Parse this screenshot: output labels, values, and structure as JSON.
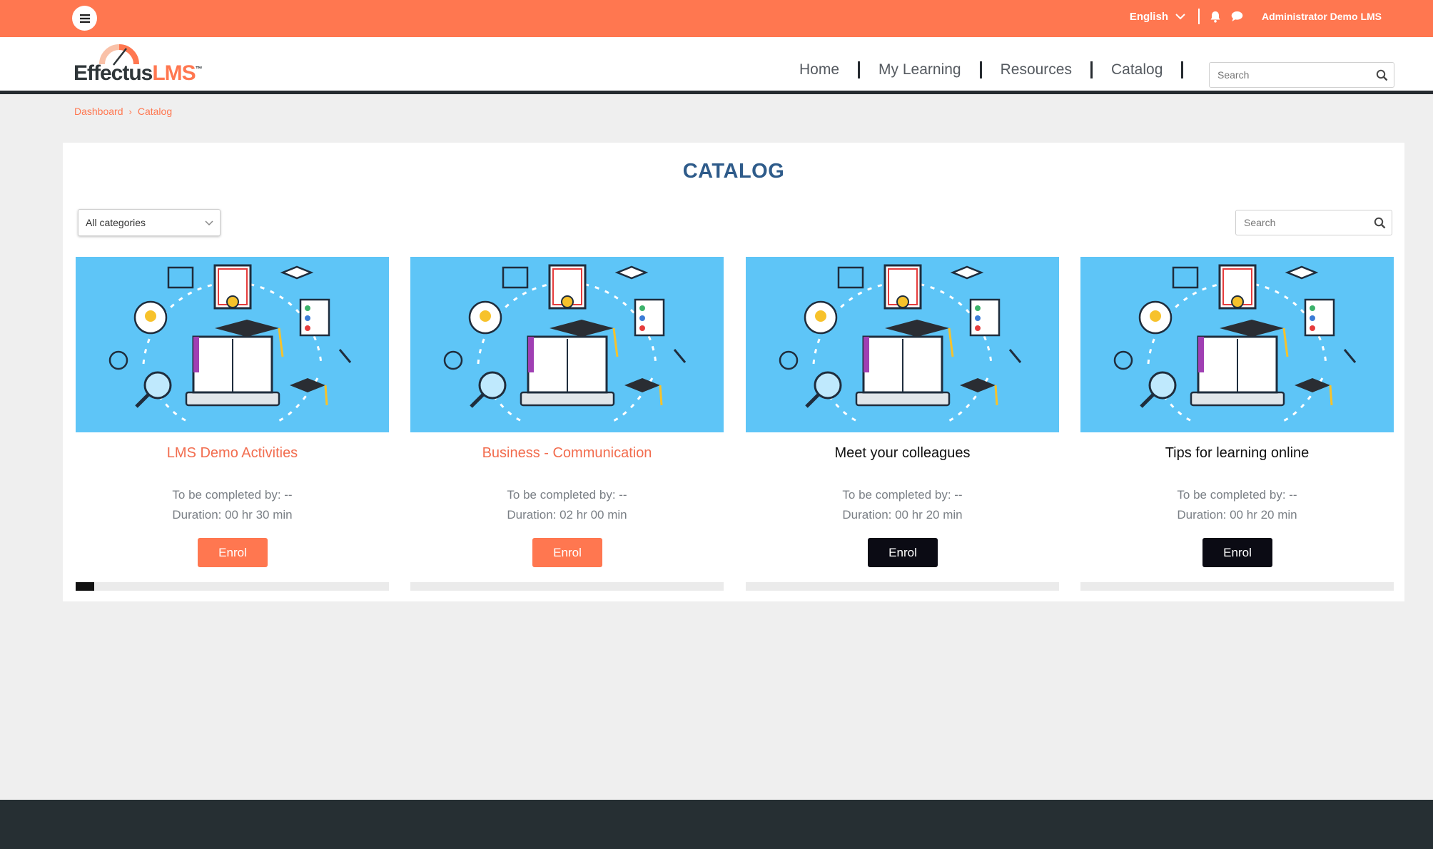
{
  "topbar": {
    "language": "English",
    "user_name": "Administrator Demo LMS"
  },
  "logo": {
    "effectus": "Effectus",
    "lms": "LMS",
    "tm": "™"
  },
  "nav": {
    "home": "Home",
    "my_learning": "My Learning",
    "resources": "Resources",
    "catalog": "Catalog"
  },
  "header_search": {
    "placeholder": "Search"
  },
  "breadcrumb": {
    "dashboard": "Dashboard",
    "catalog": "Catalog"
  },
  "main": {
    "title": "CATALOG",
    "category_filter": "All categories",
    "search_placeholder": "Search"
  },
  "courses": [
    {
      "title": "LMS Demo Activities",
      "completed_by": "To be completed by: --",
      "duration": "Duration: 00 hr 30 min",
      "button": "Enrol",
      "title_color": "#f26d4f",
      "button_color": "#ff7750",
      "progress": 0.06
    },
    {
      "title": "Business - Communication",
      "completed_by": "To be completed by: --",
      "duration": "Duration: 02 hr 00 min",
      "button": "Enrol",
      "title_color": "#f26d4f",
      "button_color": "#ff7750",
      "progress": 0
    },
    {
      "title": "Meet your colleagues",
      "completed_by": "To be completed by: --",
      "duration": "Duration: 00 hr 20 min",
      "button": "Enrol",
      "title_color": "#111111",
      "button_color": "#0b0b14",
      "progress": 0
    },
    {
      "title": "Tips for learning online",
      "completed_by": "To be completed by: --",
      "duration": "Duration: 00 hr 20 min",
      "button": "Enrol",
      "title_color": "#111111",
      "button_color": "#0b0b14",
      "progress": 0
    }
  ],
  "colors": {
    "accent": "#ff7750",
    "title_blue": "#2e5b8a",
    "footer": "#262f33",
    "card_image_bg": "#5ec5f7"
  }
}
